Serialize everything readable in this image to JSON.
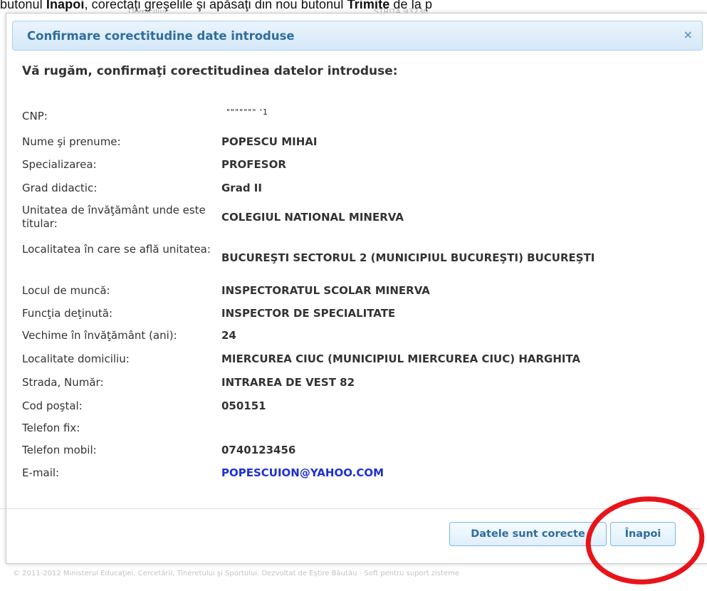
{
  "background_caption": {
    "pre": "butonul ",
    "bold1": "Înapoi",
    "mid": ", corectaţi greşelile şi apăsaţi din nou butonul ",
    "bold2": "Trimite",
    "post": " de la p"
  },
  "background_behind": {
    "left": "Domiciliul:",
    "right": "STRITA 93230"
  },
  "dialog": {
    "title": "Confirmare corectitudine date introduse",
    "close_symbol": "×",
    "heading": "Vă rugăm, confirmaţi corectitudinea datelor introduse:",
    "cnp_visible_fragment": "\"\"\"\"\"\"\"      '1",
    "fields": [
      {
        "label": "CNP:",
        "value": ""
      },
      {
        "label": "Nume şi prenume:",
        "value": "POPESCU MIHAI"
      },
      {
        "label": "Specializarea:",
        "value": "PROFESOR"
      },
      {
        "label": "Grad didactic:",
        "value": "Grad II"
      },
      {
        "label": "Unitatea de învăţământ unde este titular:",
        "value": "COLEGIUL NATIONAL MINERVA"
      },
      {
        "label": "Localitatea în care se află unitatea:",
        "value": "BUCUREŞTI SECTORUL 2 (MUNICIPIUL BUCUREŞTI) BUCUREŞTI"
      },
      {
        "label": "Locul de muncă:",
        "value": "INSPECTORATUL SCOLAR MINERVA"
      },
      {
        "label": "Funcţia deţinută:",
        "value": "INSPECTOR DE SPECIALITATE"
      },
      {
        "label": "Vechime în învăţământ (ani):",
        "value": "24"
      },
      {
        "label": "Localitate domiciliu:",
        "value": "MIERCUREA CIUC (MUNICIPIUL MIERCUREA CIUC) HARGHITA"
      },
      {
        "label": "Strada, Număr:",
        "value": "INTRAREA DE VEST 82"
      },
      {
        "label": "Cod poştal:",
        "value": "050151"
      },
      {
        "label": "Telefon fix:",
        "value": ""
      },
      {
        "label": "Telefon mobil:",
        "value": "0740123456"
      },
      {
        "label": "E-mail:",
        "value": "POPESCUION@YAHOO.COM"
      }
    ],
    "buttons": {
      "confirm": "Datele sunt corecte",
      "back": "Înapoi"
    }
  },
  "footer": "© 2011-2012 Ministerul Educaţiei, Cercetării, Tineretului şi Sportului. Dezvoltat de Eștire Băutău - Soft pentru suport zisteme",
  "colors": {
    "title_text": "#2e6e9e",
    "email": "#1d31d6",
    "annotation_circle": "#e8141a"
  }
}
